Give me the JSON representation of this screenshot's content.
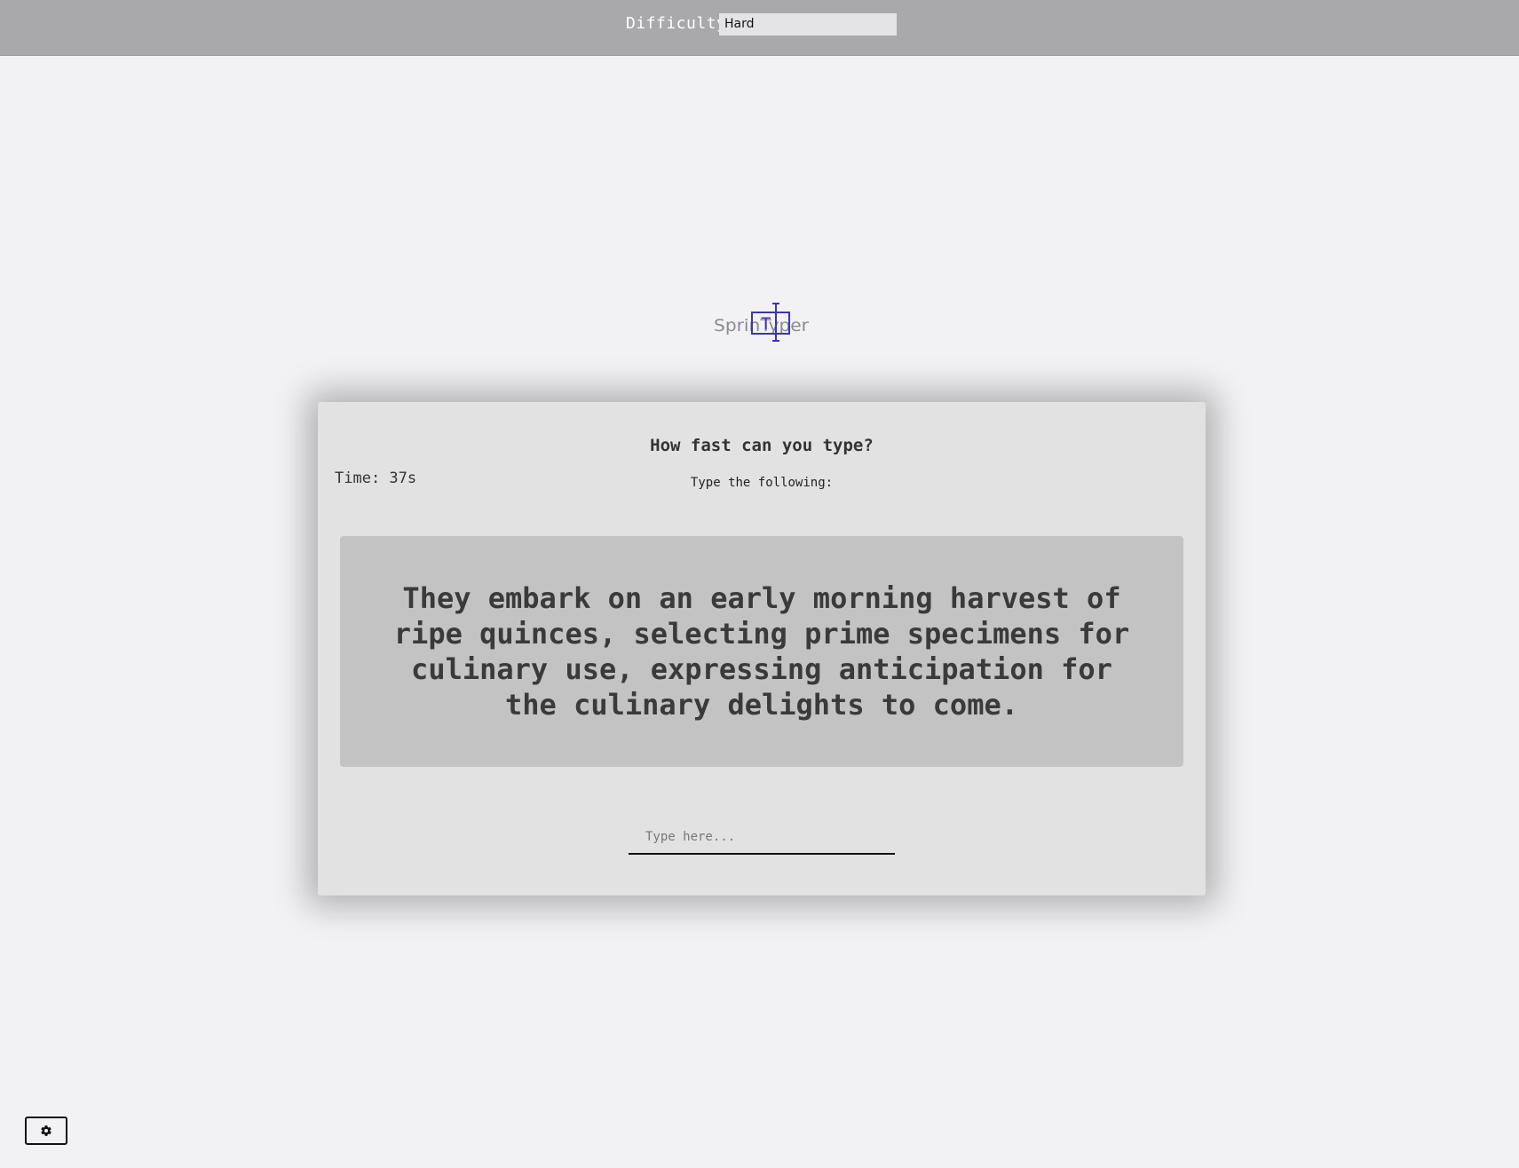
{
  "header": {
    "difficulty_label": "Difficulty",
    "difficulty_value": "Hard"
  },
  "logo": {
    "text": "SprinTyper",
    "accent_color": "#3a36b0",
    "text_color": "#8a8a92"
  },
  "card": {
    "title": "How fast can you type?",
    "timer": "Time: 37s",
    "instruction": "Type the following:",
    "passage": "They embark on an early morning harvest of ripe quinces, selecting prime specimens for culinary use, expressing anticipation for the culinary delights to come.",
    "input_placeholder": "Type here..."
  },
  "footer": {
    "settings_icon": "gear-icon"
  }
}
